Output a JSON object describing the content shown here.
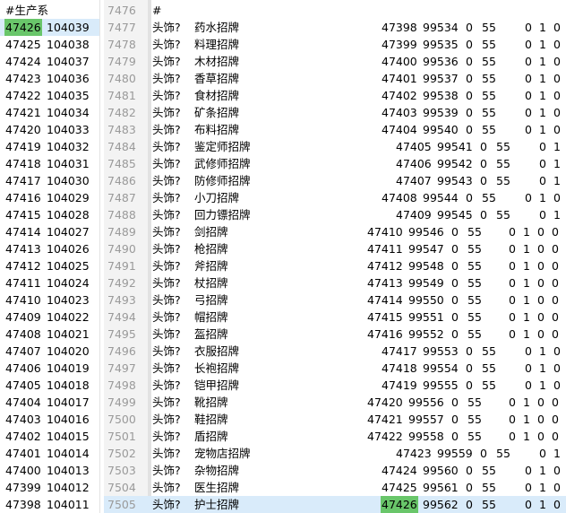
{
  "left_panel": {
    "header": "#生产系",
    "rows": [
      [
        "47426",
        "104039"
      ],
      [
        "47425",
        "104038"
      ],
      [
        "47424",
        "104037"
      ],
      [
        "47423",
        "104036"
      ],
      [
        "47422",
        "104035"
      ],
      [
        "47421",
        "104034"
      ],
      [
        "47420",
        "104033"
      ],
      [
        "47419",
        "104032"
      ],
      [
        "47418",
        "104031"
      ],
      [
        "47417",
        "104030"
      ],
      [
        "47416",
        "104029"
      ],
      [
        "47415",
        "104028"
      ],
      [
        "47414",
        "104027"
      ],
      [
        "47413",
        "104026"
      ],
      [
        "47412",
        "104025"
      ],
      [
        "47411",
        "104024"
      ],
      [
        "47410",
        "104023"
      ],
      [
        "47409",
        "104022"
      ],
      [
        "47408",
        "104021"
      ],
      [
        "47407",
        "104020"
      ],
      [
        "47406",
        "104019"
      ],
      [
        "47405",
        "104018"
      ],
      [
        "47404",
        "104017"
      ],
      [
        "47403",
        "104016"
      ],
      [
        "47402",
        "104015"
      ],
      [
        "47401",
        "104014"
      ],
      [
        "47400",
        "104013"
      ],
      [
        "47399",
        "104012"
      ],
      [
        "47398",
        "104011"
      ]
    ]
  },
  "editor": {
    "header": {
      "line": "7476",
      "text": "#"
    },
    "rows": [
      {
        "line": "7477",
        "type": "头饰?",
        "name": "药水招牌",
        "id": "47398",
        "code": "99534",
        "a": "0",
        "b": "55",
        "c": "0",
        "d": "1",
        "e": "0"
      },
      {
        "line": "7478",
        "type": "头饰?",
        "name": "料理招牌",
        "id": "47399",
        "code": "99535",
        "a": "0",
        "b": "55",
        "c": "0",
        "d": "1",
        "e": "0"
      },
      {
        "line": "7479",
        "type": "头饰?",
        "name": "木材招牌",
        "id": "47400",
        "code": "99536",
        "a": "0",
        "b": "55",
        "c": "0",
        "d": "1",
        "e": "0"
      },
      {
        "line": "7480",
        "type": "头饰?",
        "name": "香草招牌",
        "id": "47401",
        "code": "99537",
        "a": "0",
        "b": "55",
        "c": "0",
        "d": "1",
        "e": "0"
      },
      {
        "line": "7481",
        "type": "头饰?",
        "name": "食材招牌",
        "id": "47402",
        "code": "99538",
        "a": "0",
        "b": "55",
        "c": "0",
        "d": "1",
        "e": "0"
      },
      {
        "line": "7482",
        "type": "头饰?",
        "name": "矿条招牌",
        "id": "47403",
        "code": "99539",
        "a": "0",
        "b": "55",
        "c": "0",
        "d": "1",
        "e": "0"
      },
      {
        "line": "7483",
        "type": "头饰?",
        "name": "布料招牌",
        "id": "47404",
        "code": "99540",
        "a": "0",
        "b": "55",
        "c": "0",
        "d": "1",
        "e": "0"
      },
      {
        "line": "7484",
        "type": "头饰?",
        "name": "鉴定师招牌",
        "id": "47405",
        "code": "99541",
        "a": "0",
        "b": "55",
        "c": "",
        "d": "0",
        "e": "1"
      },
      {
        "line": "7485",
        "type": "头饰?",
        "name": "武修师招牌",
        "id": "47406",
        "code": "99542",
        "a": "0",
        "b": "55",
        "c": "",
        "d": "0",
        "e": "1"
      },
      {
        "line": "7486",
        "type": "头饰?",
        "name": "防修师招牌",
        "id": "47407",
        "code": "99543",
        "a": "0",
        "b": "55",
        "c": "",
        "d": "0",
        "e": "1"
      },
      {
        "line": "7487",
        "type": "头饰?",
        "name": "小刀招牌",
        "id": "47408",
        "code": "99544",
        "a": "0",
        "b": "55",
        "c": "0",
        "d": "1",
        "e": "0"
      },
      {
        "line": "7488",
        "type": "头饰?",
        "name": "回力镖招牌",
        "id": "47409",
        "code": "99545",
        "a": "0",
        "b": "55",
        "c": "",
        "d": "0",
        "e": "1"
      },
      {
        "line": "7489",
        "type": "头饰?",
        "name": "剑招牌",
        "id": "47410",
        "code": "99546",
        "a": "0",
        "b": "55",
        "c": "0",
        "d": "1",
        "e": "0",
        "f": "0"
      },
      {
        "line": "7490",
        "type": "头饰?",
        "name": "枪招牌",
        "id": "47411",
        "code": "99547",
        "a": "0",
        "b": "55",
        "c": "0",
        "d": "1",
        "e": "0",
        "f": "0"
      },
      {
        "line": "7491",
        "type": "头饰?",
        "name": "斧招牌",
        "id": "47412",
        "code": "99548",
        "a": "0",
        "b": "55",
        "c": "0",
        "d": "1",
        "e": "0",
        "f": "0"
      },
      {
        "line": "7492",
        "type": "头饰?",
        "name": "杖招牌",
        "id": "47413",
        "code": "99549",
        "a": "0",
        "b": "55",
        "c": "0",
        "d": "1",
        "e": "0",
        "f": "0"
      },
      {
        "line": "7493",
        "type": "头饰?",
        "name": "弓招牌",
        "id": "47414",
        "code": "99550",
        "a": "0",
        "b": "55",
        "c": "0",
        "d": "1",
        "e": "0",
        "f": "0"
      },
      {
        "line": "7494",
        "type": "头饰?",
        "name": "帽招牌",
        "id": "47415",
        "code": "99551",
        "a": "0",
        "b": "55",
        "c": "0",
        "d": "1",
        "e": "0",
        "f": "0"
      },
      {
        "line": "7495",
        "type": "头饰?",
        "name": "盔招牌",
        "id": "47416",
        "code": "99552",
        "a": "0",
        "b": "55",
        "c": "0",
        "d": "1",
        "e": "0",
        "f": "0"
      },
      {
        "line": "7496",
        "type": "头饰?",
        "name": "衣服招牌",
        "id": "47417",
        "code": "99553",
        "a": "0",
        "b": "55",
        "c": "0",
        "d": "1",
        "e": "0"
      },
      {
        "line": "7497",
        "type": "头饰?",
        "name": "长袍招牌",
        "id": "47418",
        "code": "99554",
        "a": "0",
        "b": "55",
        "c": "0",
        "d": "1",
        "e": "0"
      },
      {
        "line": "7498",
        "type": "头饰?",
        "name": "铠甲招牌",
        "id": "47419",
        "code": "99555",
        "a": "0",
        "b": "55",
        "c": "0",
        "d": "1",
        "e": "0"
      },
      {
        "line": "7499",
        "type": "头饰?",
        "name": "靴招牌",
        "id": "47420",
        "code": "99556",
        "a": "0",
        "b": "55",
        "c": "0",
        "d": "1",
        "e": "0",
        "f": "0"
      },
      {
        "line": "7500",
        "type": "头饰?",
        "name": "鞋招牌",
        "id": "47421",
        "code": "99557",
        "a": "0",
        "b": "55",
        "c": "0",
        "d": "1",
        "e": "0",
        "f": "0"
      },
      {
        "line": "7501",
        "type": "头饰?",
        "name": "盾招牌",
        "id": "47422",
        "code": "99558",
        "a": "0",
        "b": "55",
        "c": "0",
        "d": "1",
        "e": "0",
        "f": "0"
      },
      {
        "line": "7502",
        "type": "头饰?",
        "name": "宠物店招牌",
        "id": "47423",
        "code": "99559",
        "a": "0",
        "b": "55",
        "c": "",
        "d": "0",
        "e": "1"
      },
      {
        "line": "7503",
        "type": "头饰?",
        "name": "杂物招牌",
        "id": "47424",
        "code": "99560",
        "a": "0",
        "b": "55",
        "c": "0",
        "d": "1",
        "e": "0"
      },
      {
        "line": "7504",
        "type": "头饰?",
        "name": "医生招牌",
        "id": "47425",
        "code": "99561",
        "a": "0",
        "b": "55",
        "c": "0",
        "d": "1",
        "e": "0"
      },
      {
        "line": "7505",
        "type": "头饰?",
        "name": "护士招牌",
        "id": "47426",
        "code": "99562",
        "a": "0",
        "b": "55",
        "c": "0",
        "d": "1",
        "e": "0"
      }
    ]
  },
  "selection": {
    "left_row": 0,
    "editor_row": 28
  },
  "colors": {
    "highlight": "#69c66a",
    "current_line": "#d9ebfa"
  }
}
